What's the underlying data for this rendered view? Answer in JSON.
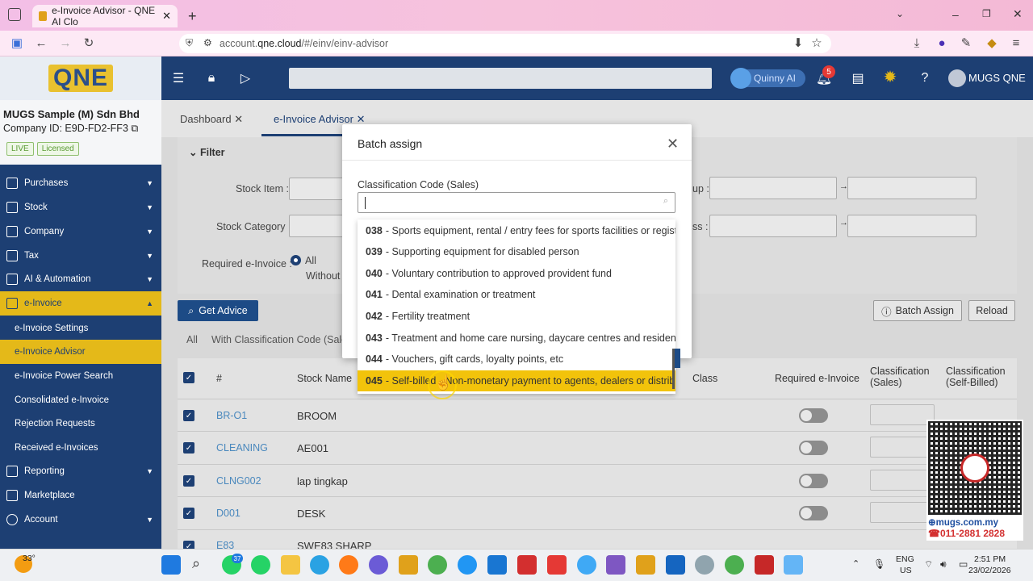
{
  "browser": {
    "tab_title": "e-Invoice Advisor - QNE AI Clo",
    "url_prefix": "account.",
    "url_domain": "qne.cloud",
    "url_path": "/#/einv/einv-advisor"
  },
  "header": {
    "logo_text": "QNE",
    "assistant_label": "Quinny AI",
    "notification_count": "5",
    "user_label": "MUGS QNE"
  },
  "company": {
    "name": "MUGS Sample (M) Sdn Bhd",
    "id_label": "Company ID: E9D-FD2-FF3",
    "tags": [
      "LIVE",
      "Licensed"
    ]
  },
  "sidebar": {
    "items": [
      {
        "label": "Purchases"
      },
      {
        "label": "Stock"
      },
      {
        "label": "Company"
      },
      {
        "label": "Tax"
      },
      {
        "label": "AI & Automation"
      },
      {
        "label": "e-Invoice"
      }
    ],
    "subitems": [
      {
        "label": "e-Invoice Settings"
      },
      {
        "label": "e-Invoice Advisor"
      },
      {
        "label": "e-Invoice Power Search"
      },
      {
        "label": "Consolidated e-Invoice"
      },
      {
        "label": "Rejection Requests"
      },
      {
        "label": "Received e-Invoices"
      }
    ],
    "bottom_items": [
      {
        "label": "Reporting"
      },
      {
        "label": "Marketplace"
      },
      {
        "label": "Account"
      }
    ]
  },
  "content": {
    "tabs": [
      {
        "label": "Dashboard"
      },
      {
        "label": "e-Invoice Advisor"
      }
    ],
    "filter": {
      "title": "Filter",
      "stock_item_label": "Stock Item :",
      "stock_category_label": "Stock Category :",
      "required_label": "Required e-Invoice :",
      "radio_all": "All",
      "radio_without": "Without",
      "right_label1": "up :",
      "right_label2": "ss :"
    },
    "buttons": {
      "get_advice": "Get Advice",
      "batch_assign": "Batch Assign",
      "reload": "Reload"
    },
    "subtabs": [
      "All",
      "With Classification Code (Sales)"
    ],
    "table": {
      "headers": [
        "#",
        "Stock Name",
        "Class",
        "Required e-Invoice",
        "Classification (Sales)",
        "Classification (Self-Billed)"
      ],
      "rows": [
        {
          "code": "BR-O1",
          "name": "BROOM"
        },
        {
          "code": "CLEANING",
          "name": "AE001"
        },
        {
          "code": "CLNG002",
          "name": "lap tingkap"
        },
        {
          "code": "D001",
          "name": "DESK"
        },
        {
          "code": "E83",
          "name": "SWE83 SHARP"
        }
      ]
    }
  },
  "modal": {
    "title": "Batch assign",
    "field_label": "Classification Code (Sales)",
    "search_value": "",
    "options": [
      {
        "code": "038",
        "text": "- Sports equipment, rental / entry fees for sports facilities or registra"
      },
      {
        "code": "039",
        "text": "- Supporting equipment for disabled person"
      },
      {
        "code": "040",
        "text": "- Voluntary contribution to approved provident fund"
      },
      {
        "code": "041",
        "text": "- Dental examination or treatment"
      },
      {
        "code": "042",
        "text": "- Fertility treatment"
      },
      {
        "code": "043",
        "text": "- Treatment and home care nursing, daycare centres and residential"
      },
      {
        "code": "044",
        "text": "- Vouchers, gift cards, loyalty points, etc"
      },
      {
        "code": "045",
        "text": "- Self-billed - Non-monetary payment to agents, dealers or distribut"
      }
    ],
    "selected_index": 7
  },
  "qr": {
    "site": "mugs.com.my",
    "phone": "011-2881 2828"
  },
  "taskbar": {
    "weather": "33°",
    "whatsapp_badge": "37",
    "lang_top": "ENG",
    "lang_bottom": "US",
    "time": "2:51 PM",
    "date": "23/02/2026"
  },
  "colors": {
    "nav_blue": "#1d3f73",
    "accent_yellow": "#e4b919",
    "highlight_yellow": "#f2c30b",
    "link_blue": "#4a88bd"
  }
}
